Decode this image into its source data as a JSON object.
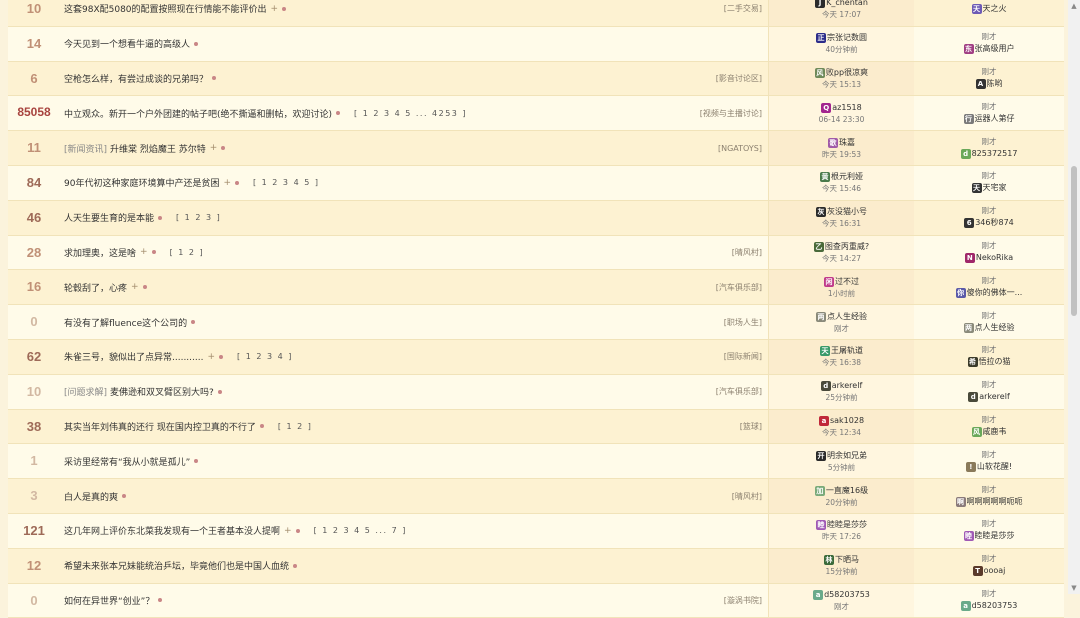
{
  "threads": [
    {
      "count": "10",
      "heat": "mid",
      "prefix": "",
      "title": "这套98X配5080的配置按照现在行情能不能评价出",
      "plus": true,
      "dot": true,
      "pages": "",
      "forum": "[二手交易]",
      "author": {
        "name": "K_chentan",
        "avatar": "J",
        "color": "#2b2b2b",
        "time": "今天 17:07"
      },
      "last": {
        "label": "",
        "name": "天之火",
        "avatar": "天",
        "color": "#6d5ab5"
      }
    },
    {
      "count": "14",
      "heat": "mid",
      "prefix": "",
      "title": "今天见到一个想看牛逼的高级人",
      "plus": false,
      "dot": true,
      "pages": "",
      "forum": "",
      "author": {
        "name": "宗张记数圆",
        "avatar": "正",
        "color": "#2d2d8a",
        "time": "40分钟前"
      },
      "last": {
        "label": "刚才",
        "name": "张高级用户",
        "avatar": "东",
        "color": "#a03e83"
      }
    },
    {
      "count": "6",
      "heat": "mid",
      "prefix": "",
      "title": "空枪怎么样，有尝过成谈的兄弟吗？",
      "plus": false,
      "dot": true,
      "pages": "",
      "forum": "[影音讨论区]",
      "author": {
        "name": "败pp很凉爽",
        "avatar": "风",
        "color": "#6f8a5a",
        "time": "今天 15:13"
      },
      "last": {
        "label": "刚才",
        "name": "陈哟",
        "avatar": "A",
        "color": "#333"
      }
    },
    {
      "count": "85058",
      "heat": "hot",
      "prefix": "",
      "title": "中立观众。新开一个户外团建的帖子吧(绝不撕逼和删帖，欢迎讨论)",
      "plus": false,
      "dot": true,
      "pages": "[ 1 2 3 4 5 ... 4253 ]",
      "forum": "[视频与主播讨论]",
      "author": {
        "name": "az1518",
        "avatar": "Q",
        "color": "#a3268f",
        "time": "06-14 23:30"
      },
      "last": {
        "label": "刚才",
        "name": "运器人第仔",
        "avatar": "行",
        "color": "#7a7a7a"
      }
    },
    {
      "count": "11",
      "heat": "mid",
      "prefix": "[新闻资讯]",
      "title": "升维棠 烈焰魔王 苏尔特",
      "plus": true,
      "dot": true,
      "pages": "",
      "forum": "[NGATOYS]",
      "author": {
        "name": "珠嘉",
        "avatar": "歌",
        "color": "#a05aa8",
        "time": "昨天 19:53"
      },
      "last": {
        "label": "刚才",
        "name": "825372517",
        "avatar": "d",
        "color": "#6aa85a"
      }
    },
    {
      "count": "84",
      "heat": "warm",
      "prefix": "",
      "title": "90年代初这种家庭环境算中产还是贫困",
      "plus": true,
      "dot": true,
      "pages": "[ 1 2 3 4 5 ]",
      "forum": "",
      "author": {
        "name": "根元利娅",
        "avatar": "黄",
        "color": "#4a7a4a",
        "time": "今天 15:46"
      },
      "last": {
        "label": "刚才",
        "name": "天宅家",
        "avatar": "天",
        "color": "#333"
      }
    },
    {
      "count": "46",
      "heat": "warm",
      "prefix": "",
      "title": "人天生要生育的是本能",
      "plus": false,
      "dot": true,
      "pages": "[ 1 2 3 ]",
      "forum": "",
      "author": {
        "name": "灰没猫小号",
        "avatar": "灰",
        "color": "#2b2b2b",
        "time": "今天 16:31"
      },
      "last": {
        "label": "刚才",
        "name": "346秒874",
        "avatar": "6",
        "color": "#333"
      }
    },
    {
      "count": "28",
      "heat": "mid",
      "prefix": "",
      "title": "求加理奥，这是啥",
      "plus": true,
      "dot": true,
      "pages": "[ 1 2 ]",
      "forum": "[晴风村]",
      "author": {
        "name": "图查丙重威?",
        "avatar": "乙",
        "color": "#4a6a3a",
        "time": "今天 14:27"
      },
      "last": {
        "label": "刚才",
        "name": "NekoRika",
        "avatar": "N",
        "color": "#a0286a"
      }
    },
    {
      "count": "16",
      "heat": "mid",
      "prefix": "",
      "title": "轮毂刮了，心疼",
      "plus": true,
      "dot": true,
      "pages": "",
      "forum": "[汽车俱乐部]",
      "author": {
        "name": "过不过",
        "avatar": "闲",
        "color": "#c03a8a",
        "time": "1小时前"
      },
      "last": {
        "label": "刚才",
        "name": "傻你的佛体一...",
        "avatar": "你",
        "color": "#5a5aa8"
      }
    },
    {
      "count": "0",
      "heat": "",
      "prefix": "",
      "title": "有没有了解fluence这个公司的",
      "plus": false,
      "dot": true,
      "pages": "",
      "forum": "[职场人生]",
      "author": {
        "name": "点人生经验",
        "avatar": "两",
        "color": "#8a8a7a",
        "time": "刚才"
      },
      "last": {
        "label": "刚才",
        "name": "点人生经验",
        "avatar": "两",
        "color": "#8a8a7a"
      }
    },
    {
      "count": "62",
      "heat": "warm",
      "prefix": "",
      "title": "朱雀三号，貌似出了点异常...........",
      "plus": true,
      "dot": true,
      "pages": "[ 1 2 3 4 ]",
      "forum": "[国际新闻]",
      "author": {
        "name": "王屠轨道",
        "avatar": "天",
        "color": "#3a9a6a",
        "time": "今天 16:38"
      },
      "last": {
        "label": "刚才",
        "name": "悟拉の猫",
        "avatar": "希",
        "color": "#3a3a2a"
      }
    },
    {
      "count": "10",
      "heat": "",
      "prefix": "[问题求解]",
      "title": "麦佛逊和双叉臂区别大吗?",
      "plus": false,
      "dot": true,
      "pages": "",
      "forum": "[汽车俱乐部]",
      "author": {
        "name": "arkerelf",
        "avatar": "d",
        "color": "#4a4a3a",
        "time": "25分钟前"
      },
      "last": {
        "label": "刚才",
        "name": "arkerelf",
        "avatar": "d",
        "color": "#4a4a3a"
      }
    },
    {
      "count": "38",
      "heat": "warm",
      "prefix": "",
      "title": "其实当年刘伟真的还行 现在国内控卫真的不行了",
      "plus": false,
      "dot": true,
      "pages": "[ 1 2 ]",
      "forum": "[篮球]",
      "author": {
        "name": "sak1028",
        "avatar": "a",
        "color": "#c0283a",
        "time": "今天 12:34"
      },
      "last": {
        "label": "刚才",
        "name": "咸鹿韦",
        "avatar": "风",
        "color": "#6aa85a"
      }
    },
    {
      "count": "1",
      "heat": "",
      "prefix": "",
      "title": "采访里经常有“我从小就是孤儿”",
      "plus": false,
      "dot": true,
      "pages": "",
      "forum": "",
      "author": {
        "name": "明余如兄弟",
        "avatar": "开",
        "color": "#2a2a2a",
        "time": "5分钟前"
      },
      "last": {
        "label": "刚才",
        "name": "山软花醒!",
        "avatar": "!",
        "color": "#8a7a5a"
      }
    },
    {
      "count": "3",
      "heat": "",
      "prefix": "",
      "title": "白人是真的爽",
      "plus": false,
      "dot": true,
      "pages": "",
      "forum": "[晴风村]",
      "author": {
        "name": "一直魔16级",
        "avatar": "加",
        "color": "#7aaa7a",
        "time": "20分钟前"
      },
      "last": {
        "label": "刚才",
        "name": "啊啊啊啊啊呃呃",
        "avatar": "啊",
        "color": "#8a7a7a"
      }
    },
    {
      "count": "121",
      "heat": "warm",
      "prefix": "",
      "title": "这几年网上评价东北菜我发现有一个王者基本没人提啊",
      "plus": true,
      "dot": true,
      "pages": "[ 1 2 3 4 5 ... 7 ]",
      "forum": "",
      "author": {
        "name": "睦睦是莎莎",
        "avatar": "睦",
        "color": "#a05ab5",
        "time": "昨天 17:26"
      },
      "last": {
        "label": "刚才",
        "name": "睦睦是莎莎",
        "avatar": "睦",
        "color": "#a05ab5"
      }
    },
    {
      "count": "12",
      "heat": "mid",
      "prefix": "",
      "title": "希望未来张本兄妹能统治乒坛，毕竟他们也是中国人血统",
      "plus": false,
      "dot": true,
      "pages": "",
      "forum": "",
      "author": {
        "name": "下晒马",
        "avatar": "林",
        "color": "#3a6a3a",
        "time": "15分钟前"
      },
      "last": {
        "label": "刚才",
        "name": "oooaj",
        "avatar": "T",
        "color": "#5a3a2a"
      }
    },
    {
      "count": "0",
      "heat": "",
      "prefix": "",
      "title": "如何在异世界“创业”？",
      "plus": false,
      "dot": true,
      "pages": "",
      "forum": "[漩涡书院]",
      "author": {
        "name": "d58203753",
        "avatar": "a",
        "color": "#6aaa8a",
        "time": "刚才"
      },
      "last": {
        "label": "刚才",
        "name": "d58203753",
        "avatar": "a",
        "color": "#6aaa8a"
      }
    }
  ],
  "plus_symbol": "+",
  "scrollbar": {
    "up": "▲",
    "down": "▼"
  }
}
